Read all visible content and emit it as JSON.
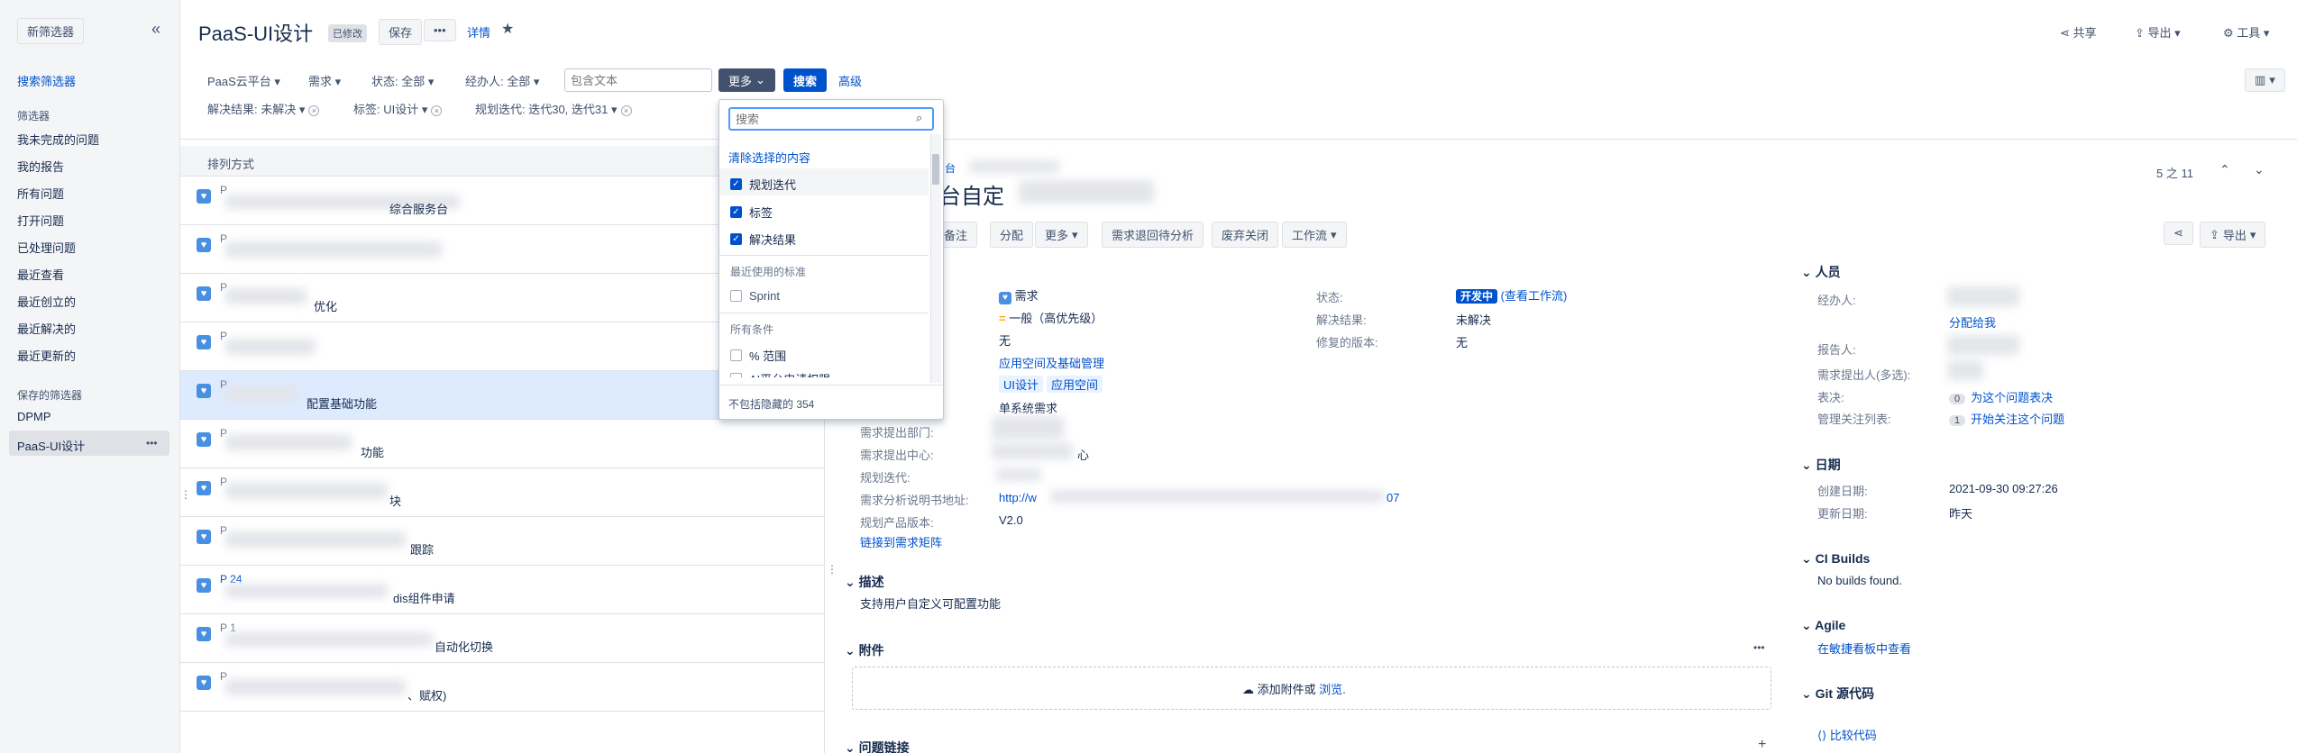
{
  "sidebar": {
    "new_filter": "新筛选器",
    "collapse": "«",
    "search_filters": "搜索筛选器",
    "filters_header": "筛选器",
    "items": [
      "我未完成的问题",
      "我的报告",
      "所有问题",
      "打开问题",
      "已处理问题",
      "最近查看",
      "最近创立的",
      "最近解决的",
      "最近更新的"
    ],
    "saved_header": "保存的筛选器",
    "saved": [
      "DPMP",
      "PaaS-UI设计"
    ],
    "saved_more": "•••"
  },
  "header": {
    "title": "PaaS-UI设计",
    "modified": "已修改",
    "save": "保存",
    "more": "•••",
    "details": "详情",
    "share": "共享",
    "export": "导出",
    "tools": "工具"
  },
  "filters": {
    "row1": [
      "PaaS云平台",
      "需求",
      "状态: 全部",
      "经办人: 全部"
    ],
    "text_placeholder": "包含文本",
    "more_btn": "更多",
    "search_btn": "搜索",
    "advanced": "高级",
    "row2": [
      "解决结果: 未解决",
      "标签: UI设计",
      "规划迭代: 迭代30, 迭代31"
    ]
  },
  "list": {
    "sort_label": "排列方式",
    "rows": [
      {
        "key": "P",
        "text": "综合服务台"
      },
      {
        "key": "P",
        "text": ""
      },
      {
        "key": "P",
        "text": "优化"
      },
      {
        "key": "P",
        "text": ""
      },
      {
        "key": "P",
        "text": "配置基础功能"
      },
      {
        "key": "P",
        "text": "功能"
      },
      {
        "key": "P",
        "text": "块"
      },
      {
        "key": "P",
        "text": "跟踪"
      },
      {
        "key": "P  24",
        "text": "dis组件申请"
      },
      {
        "key": "P  1",
        "text": "自动化切换"
      },
      {
        "key": "P",
        "text": "、赋权)"
      }
    ]
  },
  "detail": {
    "breadcrumb": "台",
    "title_part": "台自定",
    "pager": "5 之 11",
    "actions": [
      "备注",
      "分配",
      "更多",
      "需求退回待分析",
      "废弃关闭",
      "工作流"
    ],
    "share_icon": "share",
    "export": "导出",
    "type_val": "需求",
    "priority_val": "一般（高优先级）",
    "none_val": "无",
    "component": "应用空间及基础管理",
    "labels": [
      "UI设计",
      "应用空间"
    ],
    "single_req": "单系统需求",
    "status_label": "状态:",
    "status_val": "开发中",
    "view_workflow": "(查看工作流)",
    "resolution_label": "解决结果:",
    "resolution_val": "未解决",
    "fix_version_label": "修复的版本:",
    "fix_version_val": "无",
    "dept_label": "需求提出部门:",
    "center_label": "需求提出中心:",
    "center_val": "心",
    "iteration_label": "规划迭代:",
    "doc_label": "需求分析说明书地址:",
    "doc_val": "http://w",
    "doc_tail": "07",
    "version_label": "规划产品版本:",
    "version_val": "V2.0",
    "matrix_link": "链接到需求矩阵",
    "desc_header": "描述",
    "desc_text": "支持用户自定义可配置功能",
    "attach_header": "附件",
    "attach_drop": "添加附件或",
    "attach_browse": "浏览.",
    "links_header": "问题链接"
  },
  "people": {
    "header": "人员",
    "assignee_label": "经办人:",
    "assign_me": "分配给我",
    "reporter_label": "报告人:",
    "proposer_label": "需求提出人(多选):",
    "votes_label": "表决:",
    "votes_count": "0",
    "vote_link": "为这个问题表决",
    "watch_label": "管理关注列表:",
    "watch_count": "1",
    "watch_link": "开始关注这个问题"
  },
  "dates": {
    "header": "日期",
    "created_label": "创建日期:",
    "created_val": "2021-09-30 09:27:26",
    "updated_label": "更新日期:",
    "updated_val": "昨天"
  },
  "ci": {
    "header": "CI Builds",
    "text": "No builds found."
  },
  "agile": {
    "header": "Agile",
    "link": "在敏捷看板中查看"
  },
  "git": {
    "header": "Git 源代码",
    "link": "比较代码"
  },
  "dropdown": {
    "search_placeholder": "搜索",
    "clear": "清除选择的内容",
    "checked": [
      "规划迭代",
      "标签",
      "解决结果"
    ],
    "recent_header": "最近使用的标准",
    "recent": [
      "Sprint"
    ],
    "all_header": "所有条件",
    "all": [
      "% 范围",
      "AI平台申请权限"
    ],
    "footer": "不包括隐藏的 354"
  },
  "colors": {
    "accent": "#0052cc",
    "selected_row": "#deebff",
    "sidebar_bg": "#f4f5f7"
  }
}
